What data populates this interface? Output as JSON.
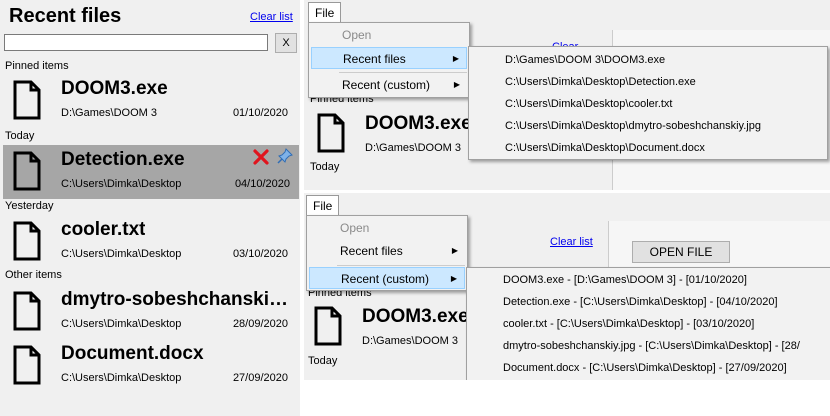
{
  "left_panel": {
    "title": "Recent files",
    "clear_list": "Clear list",
    "search": {
      "value": "",
      "placeholder": ""
    },
    "clear_search": "X",
    "sections": {
      "pinned": "Pinned items",
      "today": "Today",
      "yesterday": "Yesterday",
      "other": "Other items"
    },
    "files": [
      {
        "name": "DOOM3.exe",
        "path": "D:\\Games\\DOOM 3",
        "date": "01/10/2020",
        "icon": "document-icon"
      },
      {
        "name": "Detection.exe",
        "path": "C:\\Users\\Dimka\\Desktop",
        "date": "04/10/2020",
        "icon": "document-icon",
        "selected": true
      },
      {
        "name": "cooler.txt",
        "path": "C:\\Users\\Dimka\\Desktop",
        "date": "03/10/2020",
        "icon": "document-icon"
      },
      {
        "name": "dmytro-sobeshchanski…",
        "path": "C:\\Users\\Dimka\\Desktop",
        "date": "28/09/2020",
        "icon": "document-icon"
      },
      {
        "name": "Document.docx",
        "path": "C:\\Users\\Dimka\\Desktop",
        "date": "27/09/2020",
        "icon": "document-icon"
      }
    ],
    "remove_icon_color": "#e0141e",
    "pin_icon_color": "#4a90d9",
    "selected_bg": "#a6a6a6"
  },
  "menu_top": {
    "file_menu": "File",
    "items": [
      "Open",
      "Recent files",
      "Recent (custom)"
    ],
    "submenu": [
      "D:\\Games\\DOOM 3\\DOOM3.exe",
      "C:\\Users\\Dimka\\Desktop\\Detection.exe",
      "C:\\Users\\Dimka\\Desktop\\cooler.txt",
      "C:\\Users\\Dimka\\Desktop\\dmytro-sobeshchanskiy.jpg",
      "C:\\Users\\Dimka\\Desktop\\Document.docx"
    ],
    "bg_pinned": "Pinned items",
    "bg_file": "DOOM3.exe",
    "bg_path": "D:\\Games\\DOOM 3",
    "bg_today": "Today",
    "bg_clear_partial": "Clear"
  },
  "menu_bottom": {
    "file_menu": "File",
    "items": [
      "Open",
      "Recent files",
      "Recent (custom)"
    ],
    "submenu": [
      "DOOM3.exe - [D:\\Games\\DOOM 3] - [01/10/2020]",
      "Detection.exe - [C:\\Users\\Dimka\\Desktop] - [04/10/2020]",
      "cooler.txt - [C:\\Users\\Dimka\\Desktop] - [03/10/2020]",
      "dmytro-sobeshchanskiy.jpg - [C:\\Users\\Dimka\\Desktop] - [28/",
      "Document.docx - [C:\\Users\\Dimka\\Desktop] - [27/09/2020]"
    ],
    "bg_clear_list": "Clear list",
    "bg_open_file": "OPEN FILE",
    "bg_pinned": "Pinned items",
    "bg_file": "DOOM3.exe",
    "bg_path": "D:\\Games\\DOOM 3",
    "bg_today": "Today"
  },
  "colors": {
    "menu_highlight": "#cce8ff",
    "menu_highlight_border": "#99d1ff",
    "link": "#0000ee"
  }
}
